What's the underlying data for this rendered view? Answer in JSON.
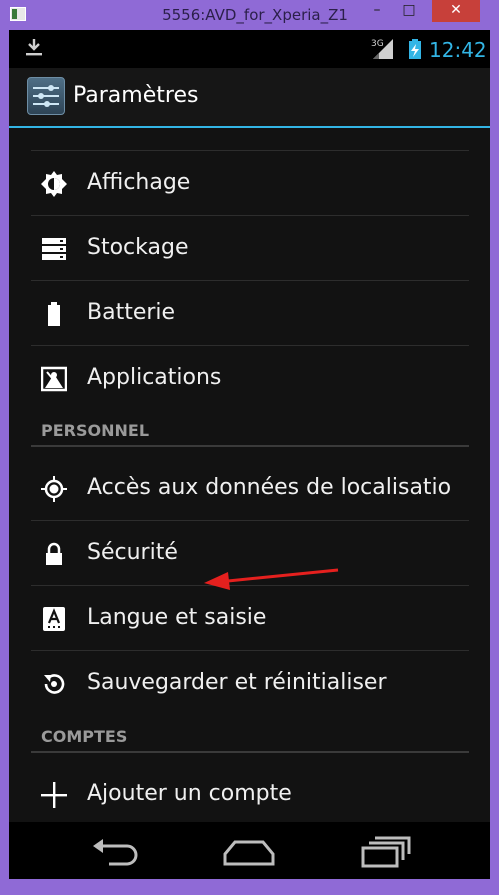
{
  "window": {
    "title": "5556:AVD_for_Xperia_Z1",
    "minimize": "–",
    "maximize": "□",
    "close": "✕"
  },
  "statusbar": {
    "network": "3G",
    "time": "12:42"
  },
  "actionbar": {
    "title": "Paramètres"
  },
  "settings": {
    "device_items": [
      {
        "label": "Affichage",
        "icon": "display-icon"
      },
      {
        "label": "Stockage",
        "icon": "storage-icon"
      },
      {
        "label": "Batterie",
        "icon": "battery-icon"
      },
      {
        "label": "Applications",
        "icon": "apps-icon"
      }
    ],
    "personal_header": "PERSONNEL",
    "personal_items": [
      {
        "label": "Accès aux données de localisatio",
        "icon": "location-icon"
      },
      {
        "label": "Sécurité",
        "icon": "lock-icon"
      },
      {
        "label": "Langue et saisie",
        "icon": "language-icon"
      },
      {
        "label": "Sauvegarder et réinitialiser",
        "icon": "backup-icon"
      }
    ],
    "accounts_header": "COMPTES",
    "accounts_items": [
      {
        "label": "Ajouter un compte",
        "icon": "add-icon"
      }
    ]
  },
  "navbar": {
    "buttons": [
      "back",
      "home",
      "recent-apps"
    ]
  },
  "colors": {
    "accent": "#33b5e5",
    "background": "#121212",
    "window_frame": "#8f6ad6",
    "annotation": "#e5201e"
  }
}
